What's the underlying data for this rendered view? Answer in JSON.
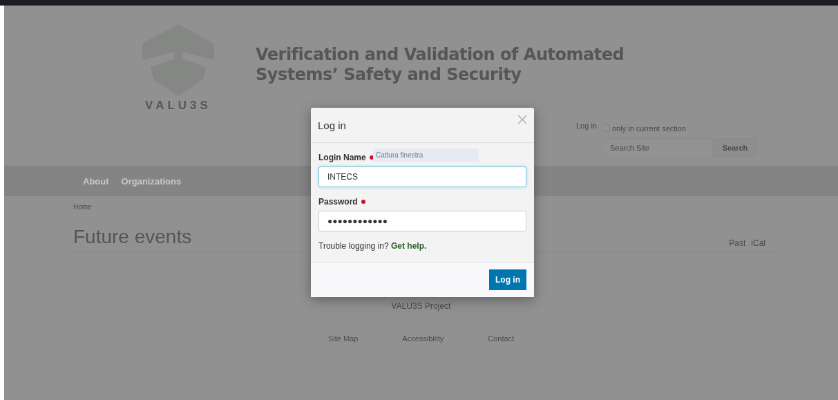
{
  "header": {
    "logo_text": "VALU3S",
    "title_lines": [
      "Verification and Validation of Automated",
      "Systems’ Safety and Security"
    ],
    "login_link": "Log in",
    "search": {
      "scope_label": "only in current section",
      "scope_checked": false,
      "placeholder": "Search Site",
      "button": "Search"
    }
  },
  "nav": {
    "items": [
      "About",
      "Organizations"
    ]
  },
  "breadcrumb": "Home",
  "page": {
    "heading": "Future events",
    "links": [
      "Past",
      "iCal"
    ]
  },
  "footer": {
    "title": "VALU3S Project",
    "links": [
      "Site Map",
      "Accessibility",
      "Contact"
    ]
  },
  "tooltip": "Cattura finestra",
  "dialog": {
    "title": "Log in",
    "fields": [
      {
        "label": "Login Name",
        "required": true,
        "value": "INTECS",
        "focused": true
      },
      {
        "label": "Password",
        "required": true,
        "value": "●●●●●●●●●●●●",
        "focused": false
      }
    ],
    "help_text": "Trouble logging in?",
    "help_link": "Get help.",
    "button": "Log in"
  }
}
